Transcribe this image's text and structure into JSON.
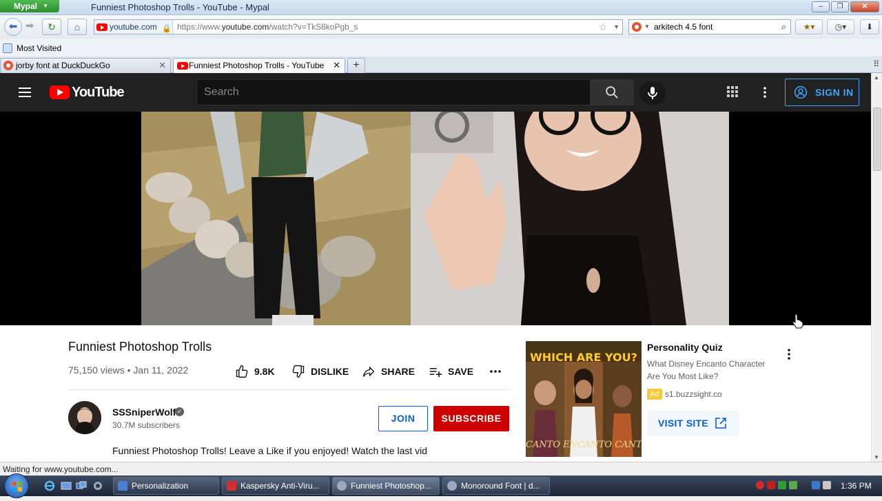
{
  "window": {
    "app_menu": "Mypal",
    "title": "Funniest Photoshop Trolls - YouTube - Mypal",
    "buttons": [
      "–",
      "❐",
      "✕"
    ]
  },
  "navbar": {
    "site_identity": "youtube.com",
    "url_prefix": "https://www.",
    "url_host": "youtube.com",
    "url_path": "/watch?v=TkS8koPgb_s",
    "search_value": "arkitech 4.5 font"
  },
  "bookmarks": {
    "most_visited": "Most Visited"
  },
  "tabs": [
    {
      "label": "jorby font at DuckDuckGo",
      "active": false
    },
    {
      "label": "Funniest Photoshop Trolls - YouTube",
      "active": true
    }
  ],
  "youtube": {
    "logo_text": "YouTube",
    "search_placeholder": "Search",
    "sign_in": "SIGN IN"
  },
  "video": {
    "title": "Funniest Photoshop Trolls",
    "views": "75,150 views",
    "date": "Jan 11, 2022",
    "likes": "9.8K",
    "dislike": "DISLIKE",
    "share": "SHARE",
    "save": "SAVE"
  },
  "channel": {
    "name": "SSSniperWolf",
    "subscribers": "30.7M subscribers",
    "join": "JOIN",
    "subscribe": "SUBSCRIBE",
    "description": "Funniest Photoshop Trolls! Leave a Like if you enjoyed! Watch the last vid"
  },
  "ad": {
    "thumb_title": "WHICH ARE YOU?",
    "thumb_footer": "CANTO  ENCANTO  CANTO",
    "title": "Personality Quiz",
    "description": "What Disney Encanto Character Are You Most Like?",
    "badge": "Ad",
    "domain": "s1.buzzsight.co",
    "cta": "VISIT SITE"
  },
  "status": {
    "text": "Waiting for www.youtube.com..."
  },
  "taskbar": {
    "tasks": [
      {
        "label": "Personalization",
        "active": false
      },
      {
        "label": "Kaspersky Anti-Viru...",
        "active": false
      },
      {
        "label": "Funniest Photoshop...",
        "active": true
      },
      {
        "label": "Monoround Font | d...",
        "active": false
      }
    ],
    "clock": "1:36 PM"
  },
  "colors": {
    "yt_red": "#ff0000",
    "yt_header": "#212121",
    "link_blue": "#065fd4",
    "subscribe_red": "#cc0000",
    "signin_blue": "#3ea6ff"
  }
}
